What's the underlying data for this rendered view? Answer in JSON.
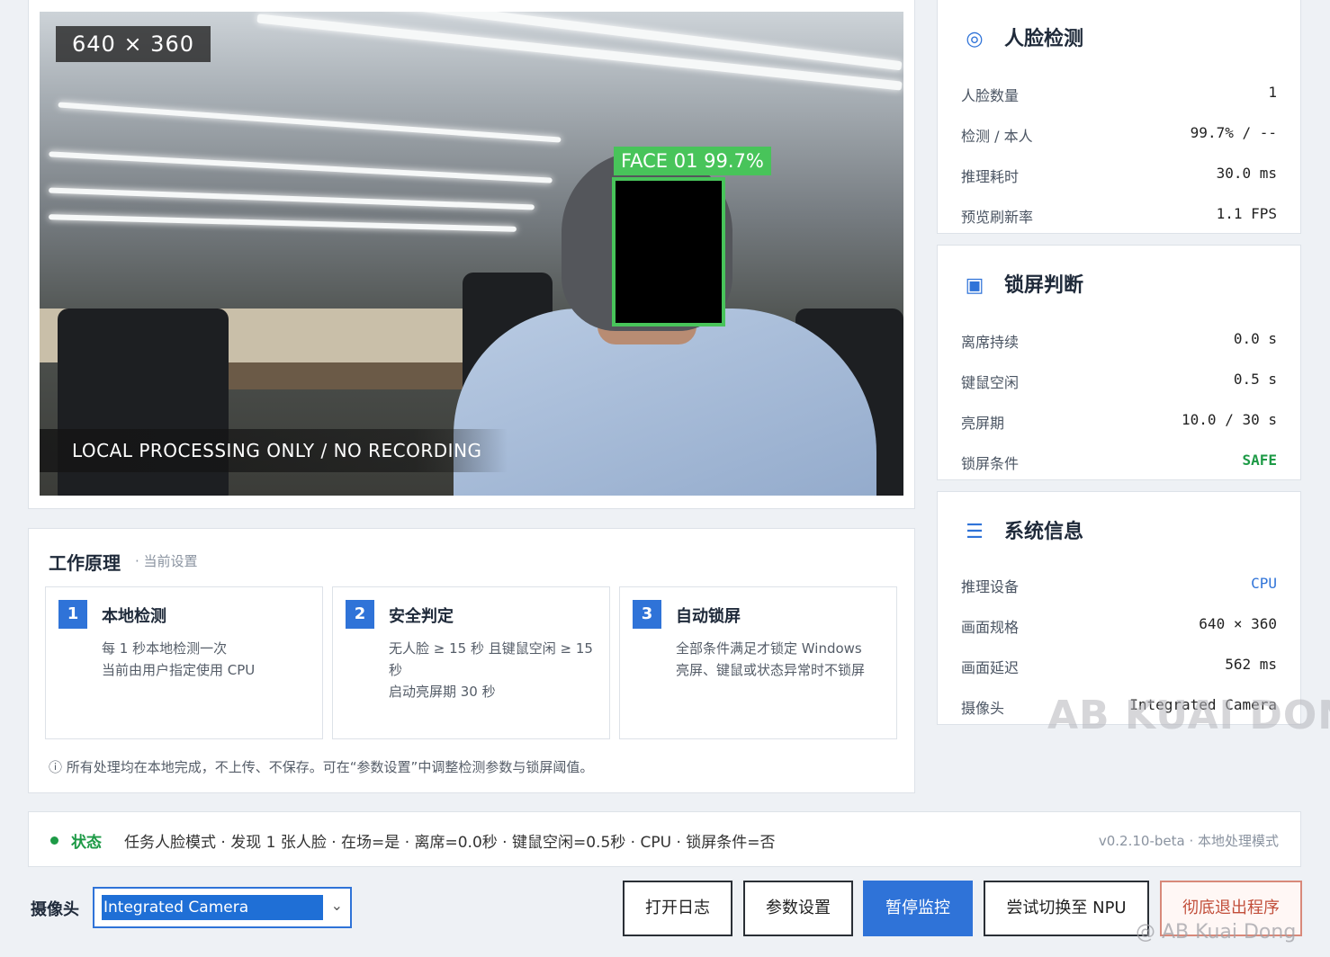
{
  "video": {
    "resolution": "640 × 360",
    "privacy": "LOCAL PROCESSING ONLY  /  NO RECORDING",
    "face_label": "FACE 01   99.7%"
  },
  "face_panel": {
    "title": "人脸检测",
    "icon": "target-icon",
    "rows": [
      {
        "label": "人脸数量",
        "value": "1"
      },
      {
        "label": "检测 / 本人",
        "value": "99.7% / --"
      },
      {
        "label": "推理耗时",
        "value": "30.0 ms"
      },
      {
        "label": "预览刷新率",
        "value": "1.1 FPS"
      }
    ]
  },
  "lock_panel": {
    "title": "锁屏判断",
    "icon": "square-icon",
    "rows": [
      {
        "label": "离席持续",
        "value": "0.0 s"
      },
      {
        "label": "键鼠空闲",
        "value": "0.5 s"
      },
      {
        "label": "亮屏期",
        "value": "10.0 / 30 s"
      },
      {
        "label": "锁屏条件",
        "value": "SAFE"
      }
    ]
  },
  "sys_panel": {
    "title": "系统信息",
    "icon": "list-icon",
    "rows": [
      {
        "label": "推理设备",
        "value": "CPU"
      },
      {
        "label": "画面规格",
        "value": "640 × 360"
      },
      {
        "label": "画面延迟",
        "value": "562 ms"
      },
      {
        "label": "摄像头",
        "value": "Integrated Camera"
      }
    ]
  },
  "how": {
    "title": "工作原理",
    "subtitle": "· 当前设置",
    "steps": [
      {
        "num": "1",
        "title": "本地检测",
        "desc": "每 1 秒本地检测一次\n当前由用户指定使用 CPU"
      },
      {
        "num": "2",
        "title": "安全判定",
        "desc": "无人脸 ≥ 15 秒 且键鼠空闲 ≥ 15 秒\n启动亮屏期 30 秒"
      },
      {
        "num": "3",
        "title": "自动锁屏",
        "desc": "全部条件满足才锁定 Windows\n亮屏、键鼠或状态异常时不锁屏"
      }
    ],
    "note": "ⓘ 所有处理均在本地完成，不上传、不保存。可在“参数设置”中调整检测参数与锁屏阈值。"
  },
  "status": {
    "label": "状态",
    "text": "任务人脸模式 · 发现 1 张人脸  ·  在场=是 · 离席=0.0秒 · 键鼠空闲=0.5秒 · CPU · 锁屏条件=否",
    "version": "v0.2.10-beta · 本地处理模式"
  },
  "bottom": {
    "camera_label": "摄像头",
    "camera_value": "Integrated Camera",
    "buttons": {
      "log": "打开日志",
      "settings": "参数设置",
      "pause": "暂停监控",
      "npu": "尝试切换至 NPU",
      "exit": "彻底退出程序"
    }
  },
  "watermark": {
    "main": "AB KUAI DONG",
    "corner": "@ AB Kuai Dong"
  }
}
